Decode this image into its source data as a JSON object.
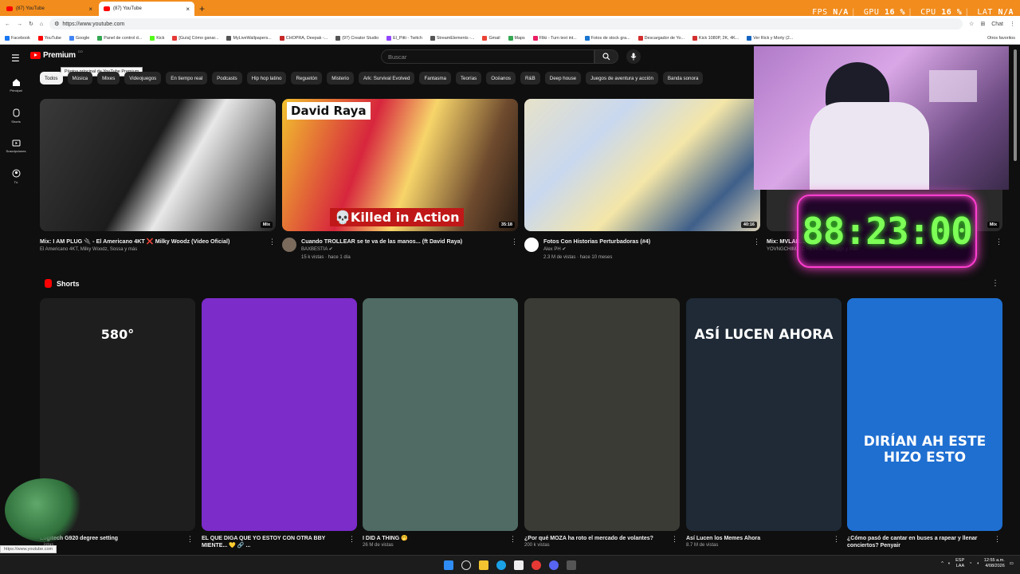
{
  "browser": {
    "tabs": [
      {
        "title": "(87) YouTube",
        "active": false
      },
      {
        "title": "(87) YouTube",
        "active": true
      }
    ],
    "new_tab": "+",
    "url": "https://www.youtube.com",
    "perf": {
      "fps_label": "FPS",
      "fps": "N/A",
      "gpu_label": "GPU",
      "gpu": "16 %",
      "cpu_label": "CPU",
      "cpu": "16 %",
      "lat_label": "LAT",
      "lat": "N/A"
    },
    "chat_label": "Chat",
    "bookmarks": [
      {
        "label": "Facebook",
        "color": "#1877f2"
      },
      {
        "label": "YouTube",
        "color": "#ff0000"
      },
      {
        "label": "Google",
        "color": "#4285f4"
      },
      {
        "label": "Panel de control d...",
        "color": "#34a853"
      },
      {
        "label": "Kick",
        "color": "#53fc18"
      },
      {
        "label": "[Guía] Cómo ganar...",
        "color": "#e53935"
      },
      {
        "label": "MyLiveWallpapers...",
        "color": "#555555"
      },
      {
        "label": "CHOPRA, Deepak -...",
        "color": "#c62828"
      },
      {
        "label": "(97) Creator Studio",
        "color": "#555555"
      },
      {
        "label": "El_Pitti - Twitch",
        "color": "#9146ff"
      },
      {
        "label": "StreamElements -...",
        "color": "#555555"
      },
      {
        "label": "Gmail",
        "color": "#ea4335"
      },
      {
        "label": "Maps",
        "color": "#34a853"
      },
      {
        "label": "Fliki - Turn text int...",
        "color": "#e91e63"
      },
      {
        "label": "Fotos de stock gra...",
        "color": "#1976d2"
      },
      {
        "label": "Descargador de Yo...",
        "color": "#d32f2f"
      },
      {
        "label": "Kick 1080P, 2K, 4K...",
        "color": "#d32f2f"
      },
      {
        "label": "Ver Rick y Morty (2...",
        "color": "#1565c0"
      }
    ],
    "other_bookmarks": "Otros favoritos"
  },
  "youtube": {
    "logo_text": "Premium",
    "logo_super": "CO",
    "tooltip": "Página principal de YouTube Premium",
    "search_placeholder": "Buscar",
    "sidebar": [
      {
        "label": "Principal",
        "icon": "home-icon"
      },
      {
        "label": "Shorts",
        "icon": "shorts-icon"
      },
      {
        "label": "Suscripciones",
        "icon": "subscriptions-icon"
      },
      {
        "label": "Tú",
        "icon": "you-icon"
      }
    ],
    "chips": [
      "Todos",
      "Música",
      "Mixes",
      "Videojuegos",
      "En tiempo real",
      "Podcasts",
      "Hip hop latino",
      "Reguetón",
      "Misterio",
      "Ark: Survival Evolved",
      "Fantasma",
      "Teorías",
      "Océanos",
      "R&B",
      "Deep house",
      "Juegos de aventura y acción",
      "Banda sonora"
    ],
    "videos": [
      {
        "title": "Mix: I AM PLUG 🔌 - El Americano 4KT ❌ Milky Woodz (Video Oficial)",
        "channel": "El Americano 4KT, Milky Woodz, Sossa y más",
        "stats": "",
        "duration": "Mix",
        "thumb_color": "#2b2b2b"
      },
      {
        "title": "Cuando TROLLEAR se te va de las manos... (ft David Raya)",
        "channel": "BAXBESTIA ✔",
        "stats": "15 k vistas · hace 1 día",
        "duration": "35:18",
        "thumb_color": "#c97a2a",
        "overlay_top": "David Raya",
        "overlay_bottom": "💀Killed in Action"
      },
      {
        "title": "Fotos Con Historias Perturbadoras (#4)",
        "channel": "Alex PH ✔",
        "stats": "2.3 M de vistas · hace 10 meses",
        "duration": "40:16",
        "thumb_color": "#d8d1b0"
      },
      {
        "title": "Mix: MVLAN...",
        "channel": "YOVNGCHIM... C REYES, Mcmiggs y más",
        "stats": "",
        "duration": "Mix",
        "thumb_color": "#303030"
      }
    ],
    "timer": "88:23:00",
    "shorts_title": "Shorts",
    "shorts": [
      {
        "title": "Logitech G920 degree setting",
        "views": "...istas",
        "bg": "#1e1e1e",
        "overlay": "580°"
      },
      {
        "title": "EL QUE DIGA QUE YO ESTOY CON OTRA BBY MIENTE... 💛 🔗 ...",
        "views": "",
        "bg": "#7b2cc9",
        "overlay": ""
      },
      {
        "title": "I DID A THING 🤭",
        "views": "26 M de vistas",
        "bg": "#4f6b63",
        "overlay": ""
      },
      {
        "title": "¿Por qué MOZA ha roto el mercado de volantes?",
        "views": "200 k vistas",
        "bg": "#3b3b35",
        "overlay": ""
      },
      {
        "title": "Así Lucen los Memes Ahora",
        "views": "8.7 M de vistas",
        "bg": "#1f2a36",
        "overlay": "ASÍ LUCEN AHORA"
      },
      {
        "title": "¿Cómo pasó de cantar en buses a rapear y llenar conciertos? Penyair",
        "views": "",
        "bg": "#1f6fd1",
        "overlay": "DIRÍAN AH ESTE HIZO ESTO"
      }
    ],
    "status_url": "https://www.youtube.com"
  },
  "taskbar": {
    "lang": "ESP",
    "lang2": "LAA",
    "time": "12:55 a.m.",
    "date": "4/08/2026"
  }
}
